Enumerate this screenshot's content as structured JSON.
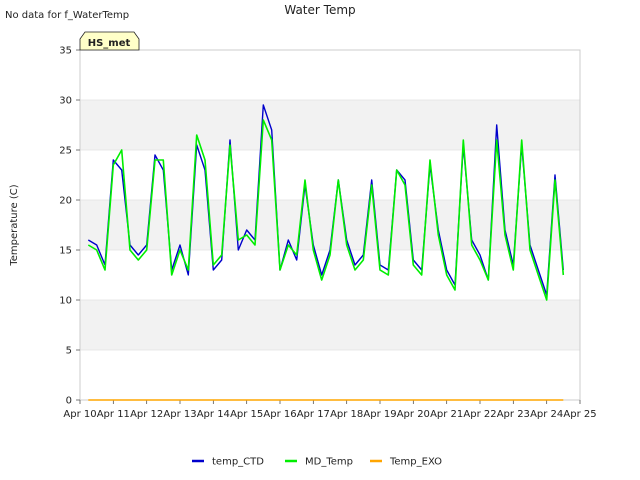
{
  "header": {
    "no_data_note": "No data for f_WaterTemp",
    "badge": "HS_met"
  },
  "chart_data": {
    "type": "line",
    "title": "Water Temp",
    "xlabel": "",
    "ylabel": "Temperature (C)",
    "x_ticks": [
      "Apr 10",
      "Apr 11",
      "Apr 12",
      "Apr 13",
      "Apr 14",
      "Apr 15",
      "Apr 16",
      "Apr 17",
      "Apr 18",
      "Apr 19",
      "Apr 20",
      "Apr 21",
      "Apr 22",
      "Apr 23",
      "Apr 24",
      "Apr 25"
    ],
    "xlim": [
      "2024-04-10",
      "2024-04-25"
    ],
    "ylim": [
      0,
      35
    ],
    "y_ticks": [
      0,
      5,
      10,
      15,
      20,
      25,
      30,
      35
    ],
    "grid": "horizontal bands",
    "legend_position": "bottom-center",
    "series": [
      {
        "name": "temp_CTD",
        "color": "#0000cc",
        "x": [
          "2024-04-10T06:00",
          "2024-04-10T12:00",
          "2024-04-10T18:00",
          "2024-04-11T00:00",
          "2024-04-11T06:00",
          "2024-04-11T12:00",
          "2024-04-11T18:00",
          "2024-04-12T00:00",
          "2024-04-12T06:00",
          "2024-04-12T12:00",
          "2024-04-12T18:00",
          "2024-04-13T00:00",
          "2024-04-13T06:00",
          "2024-04-13T12:00",
          "2024-04-13T18:00",
          "2024-04-14T00:00",
          "2024-04-14T06:00",
          "2024-04-14T12:00",
          "2024-04-14T18:00",
          "2024-04-15T00:00",
          "2024-04-15T06:00",
          "2024-04-15T12:00",
          "2024-04-15T18:00",
          "2024-04-16T00:00",
          "2024-04-16T06:00",
          "2024-04-16T12:00",
          "2024-04-16T18:00",
          "2024-04-17T00:00",
          "2024-04-17T06:00",
          "2024-04-17T12:00",
          "2024-04-17T18:00",
          "2024-04-18T00:00",
          "2024-04-18T06:00",
          "2024-04-18T12:00",
          "2024-04-18T18:00",
          "2024-04-19T00:00",
          "2024-04-19T06:00",
          "2024-04-19T12:00",
          "2024-04-19T18:00",
          "2024-04-20T00:00",
          "2024-04-20T06:00",
          "2024-04-20T12:00",
          "2024-04-20T18:00",
          "2024-04-21T00:00",
          "2024-04-21T06:00",
          "2024-04-21T12:00",
          "2024-04-21T18:00",
          "2024-04-22T00:00",
          "2024-04-22T06:00",
          "2024-04-22T12:00",
          "2024-04-22T18:00",
          "2024-04-23T00:00",
          "2024-04-23T06:00",
          "2024-04-23T12:00",
          "2024-04-23T18:00",
          "2024-04-24T00:00",
          "2024-04-24T06:00",
          "2024-04-24T12:00"
        ],
        "values": [
          16,
          15.5,
          13.5,
          24,
          23,
          15.5,
          14.5,
          15.5,
          24.5,
          23,
          13,
          15.5,
          12.5,
          25.5,
          23,
          13,
          14,
          26,
          15,
          17,
          16,
          29.5,
          27,
          13,
          16,
          14,
          21.5,
          15.5,
          12.5,
          15,
          22,
          16,
          13.5,
          14.5,
          22,
          13.5,
          13,
          23,
          22,
          14,
          13,
          23.5,
          17,
          13,
          11.5,
          25.5,
          16,
          14.5,
          12,
          27.5,
          17,
          13.5,
          25.5,
          15.5,
          13,
          10.5,
          22.5,
          13
        ]
      },
      {
        "name": "MD_Temp",
        "color": "#00ee00",
        "x": [
          "2024-04-10T06:00",
          "2024-04-10T12:00",
          "2024-04-10T18:00",
          "2024-04-11T00:00",
          "2024-04-11T06:00",
          "2024-04-11T12:00",
          "2024-04-11T18:00",
          "2024-04-12T00:00",
          "2024-04-12T06:00",
          "2024-04-12T12:00",
          "2024-04-12T18:00",
          "2024-04-13T00:00",
          "2024-04-13T06:00",
          "2024-04-13T12:00",
          "2024-04-13T18:00",
          "2024-04-14T00:00",
          "2024-04-14T06:00",
          "2024-04-14T12:00",
          "2024-04-14T18:00",
          "2024-04-15T00:00",
          "2024-04-15T06:00",
          "2024-04-15T12:00",
          "2024-04-15T18:00",
          "2024-04-16T00:00",
          "2024-04-16T06:00",
          "2024-04-16T12:00",
          "2024-04-16T18:00",
          "2024-04-17T00:00",
          "2024-04-17T06:00",
          "2024-04-17T12:00",
          "2024-04-17T18:00",
          "2024-04-18T00:00",
          "2024-04-18T06:00",
          "2024-04-18T12:00",
          "2024-04-18T18:00",
          "2024-04-19T00:00",
          "2024-04-19T06:00",
          "2024-04-19T12:00",
          "2024-04-19T18:00",
          "2024-04-20T00:00",
          "2024-04-20T06:00",
          "2024-04-20T12:00",
          "2024-04-20T18:00",
          "2024-04-21T00:00",
          "2024-04-21T06:00",
          "2024-04-21T12:00",
          "2024-04-21T18:00",
          "2024-04-22T00:00",
          "2024-04-22T06:00",
          "2024-04-22T12:00",
          "2024-04-22T18:00",
          "2024-04-23T00:00",
          "2024-04-23T06:00",
          "2024-04-23T12:00",
          "2024-04-23T18:00",
          "2024-04-24T00:00",
          "2024-04-24T06:00",
          "2024-04-24T12:00"
        ],
        "values": [
          15.5,
          15,
          13,
          23.5,
          25,
          15,
          14,
          15,
          24,
          24,
          12.5,
          15,
          13,
          26.5,
          24,
          13.5,
          14.5,
          25.5,
          16,
          16.5,
          15.5,
          28,
          26,
          13,
          15.5,
          14.5,
          22,
          15,
          12,
          14.5,
          22,
          15.5,
          13,
          14,
          21.5,
          13,
          12.5,
          23,
          21.5,
          13.5,
          12.5,
          24,
          16.5,
          12.5,
          11,
          26,
          15.5,
          14,
          12,
          26,
          16.5,
          13,
          26,
          15,
          12.5,
          10,
          22,
          12.5
        ]
      },
      {
        "name": "Temp_EXO",
        "color": "#ffa500",
        "x": [
          "2024-04-10T06:00",
          "2024-04-24T12:00"
        ],
        "values": [
          0,
          0
        ]
      }
    ]
  }
}
